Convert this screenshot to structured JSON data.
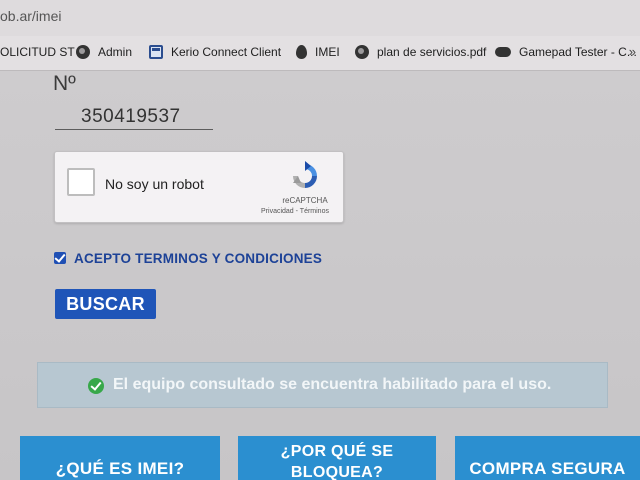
{
  "browser": {
    "url": "ob.ar/imei",
    "bookmarks": [
      {
        "label": "OLICITUD ST",
        "icon": "none"
      },
      {
        "label": "Admin",
        "icon": "globe-icon"
      },
      {
        "label": "Kerio Connect Client",
        "icon": "kerio-icon"
      },
      {
        "label": "IMEI",
        "icon": "drop-icon"
      },
      {
        "label": "plan de servicios.pdf",
        "icon": "globe-icon"
      },
      {
        "label": "Gamepad Tester - C...",
        "icon": "gamepad-icon"
      }
    ],
    "overflow_label": "»"
  },
  "form": {
    "number_label": "Nº",
    "imei_value": "350419537",
    "recaptcha": {
      "label": "No soy un robot",
      "brand": "reCAPTCHA",
      "links": "Privacidad - Términos",
      "checked": false
    },
    "terms": {
      "label": "ACEPTO TERMINOS Y CONDICIONES",
      "checked": true
    },
    "search_button": "BUSCAR"
  },
  "result": {
    "message": "El equipo consultado se encuentra habilitado para el uso.",
    "status": "success",
    "color": "#37a84a"
  },
  "info_buttons": {
    "que_es": "¿QUÉ ES IMEI?",
    "por_que_line1": "¿POR QUÉ SE",
    "por_que_line2": "BLOQUEA?",
    "compra": "COMPRA SEGURA"
  },
  "colors": {
    "primary_blue": "#1f55b8",
    "info_blue": "#2b8fd0",
    "terms_text": "#1d4297"
  }
}
